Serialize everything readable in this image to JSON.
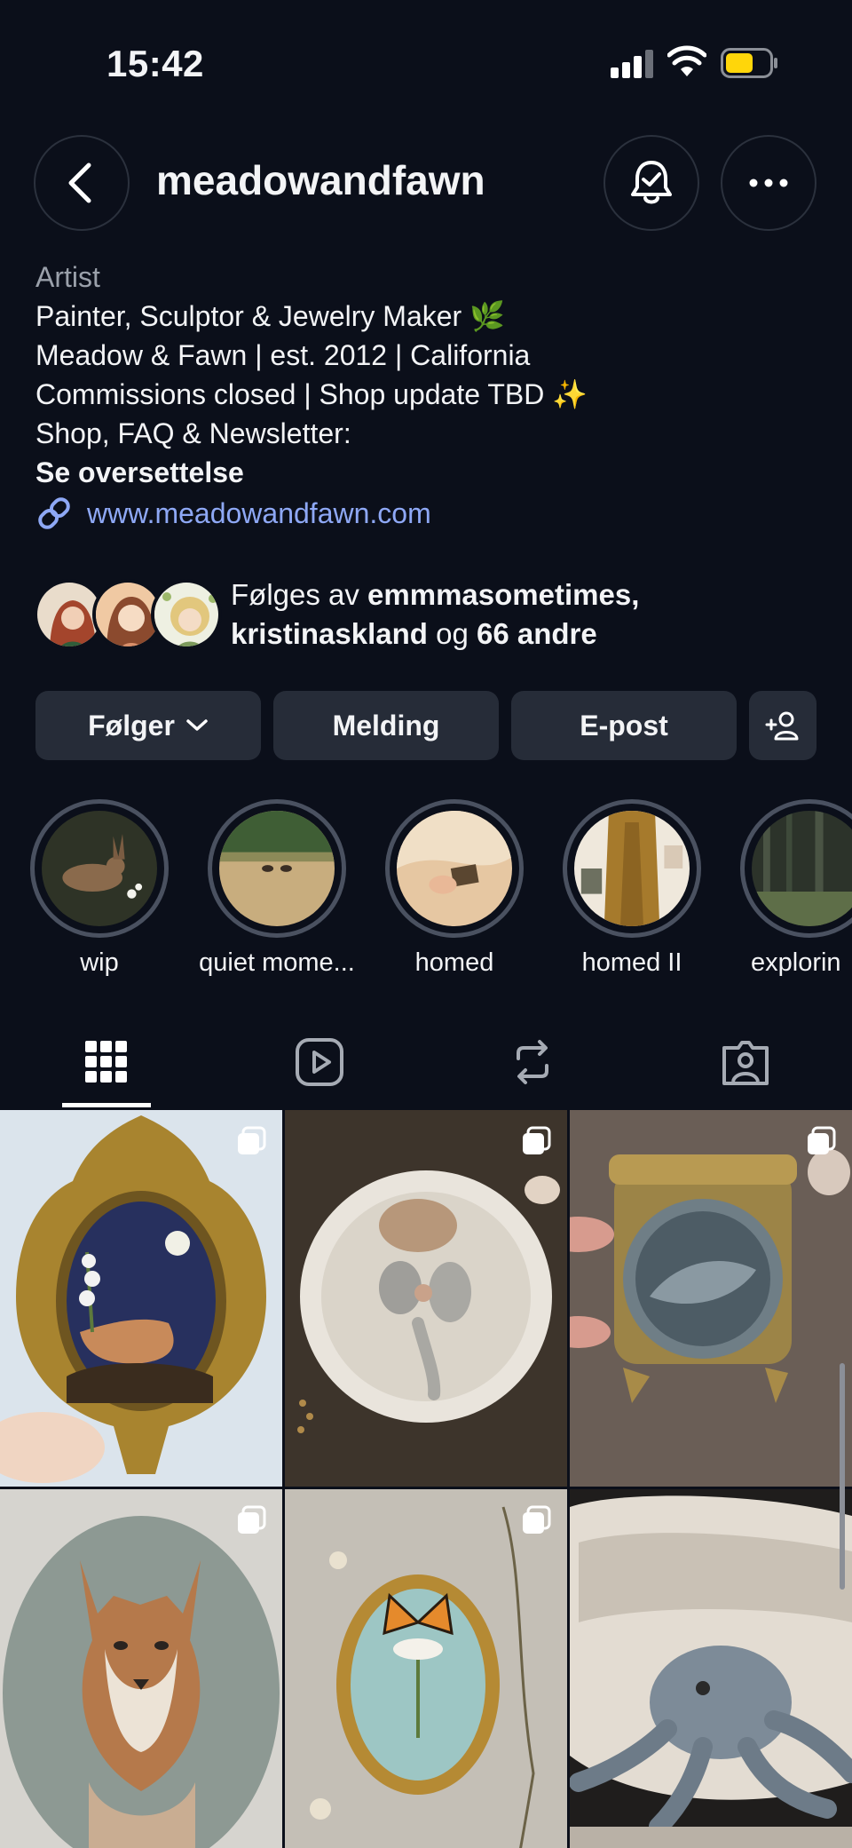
{
  "status": {
    "time": "15:42"
  },
  "header": {
    "username": "meadowandfawn"
  },
  "bio": {
    "category": "Artist",
    "lines": [
      "Painter, Sculptor & Jewelry Maker 🌿",
      "Meadow & Fawn | est. 2012 | California",
      "Commissions closed | Shop update TBD ✨",
      "Shop, FAQ & Newsletter:"
    ],
    "translate": "Se oversettelse",
    "link": "www.meadowandfawn.com"
  },
  "followed_by": {
    "prefix": "Følges av ",
    "user1": "emmmasometimes,",
    "user2": "kristinaskland",
    "joiner": " og ",
    "others": "66 andre"
  },
  "actions": {
    "following": "Følger",
    "message": "Melding",
    "email": "E-post"
  },
  "highlights": [
    {
      "label": "wip"
    },
    {
      "label": "quiet mome..."
    },
    {
      "label": "homed"
    },
    {
      "label": "homed II"
    },
    {
      "label": "explorin"
    }
  ],
  "tabs": [
    "grid-icon",
    "reels-icon",
    "reposts-icon",
    "tagged-icon"
  ],
  "colors": {
    "background": "#0b0f1a",
    "button": "#262c38",
    "link": "#8ea8f5",
    "battery": "#ffd60a"
  }
}
